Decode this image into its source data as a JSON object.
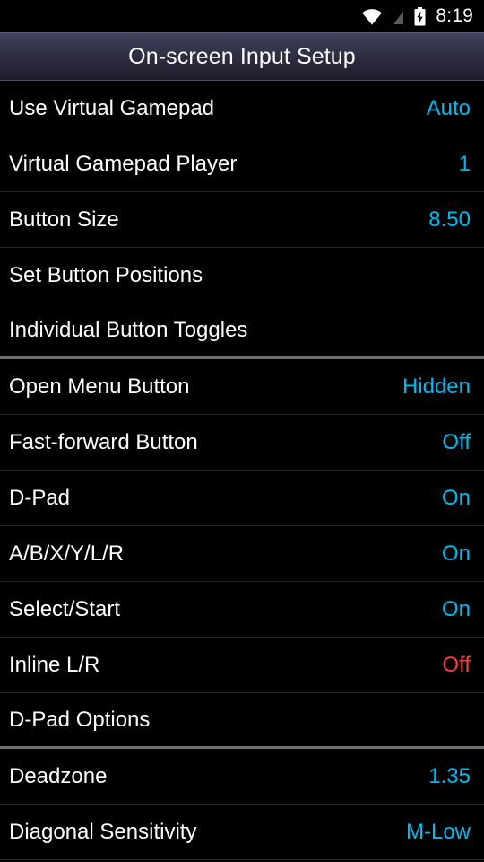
{
  "status_bar": {
    "icons": [
      {
        "name": "wifi-icon",
        "label": "wifi"
      },
      {
        "name": "signal-off-icon",
        "label": "no-signal"
      },
      {
        "name": "battery-charging-icon",
        "label": "battery-charging"
      }
    ],
    "time": "8:19"
  },
  "title_bar": {
    "title": "On-screen Input Setup"
  },
  "colors": {
    "accent": "#00baf0",
    "warn": "#f4433c",
    "background": "#000000",
    "label": "#ffffff",
    "divider": "#262626",
    "section_divider": "#6e6e6e",
    "title_bar_top": "#434360",
    "title_bar_bottom": "#1d1d2a"
  },
  "settings": [
    {
      "label": "Use Virtual Gamepad",
      "value": "Auto",
      "value_style": "accent",
      "section_end": false
    },
    {
      "label": "Virtual Gamepad Player",
      "value": "1",
      "value_style": "accent",
      "section_end": false
    },
    {
      "label": "Button Size",
      "value": "8.50",
      "value_style": "accent",
      "section_end": false
    },
    {
      "label": "Set Button Positions",
      "value": "",
      "value_style": "accent",
      "section_end": false
    },
    {
      "label": "Individual Button Toggles",
      "value": "",
      "value_style": "accent",
      "section_end": true
    },
    {
      "label": "Open Menu Button",
      "value": "Hidden",
      "value_style": "accent",
      "section_end": false
    },
    {
      "label": "Fast-forward Button",
      "value": "Off",
      "value_style": "accent",
      "section_end": false
    },
    {
      "label": "D-Pad",
      "value": "On",
      "value_style": "accent",
      "section_end": false
    },
    {
      "label": "A/B/X/Y/L/R",
      "value": "On",
      "value_style": "accent",
      "section_end": false
    },
    {
      "label": "Select/Start",
      "value": "On",
      "value_style": "accent",
      "section_end": false
    },
    {
      "label": "Inline L/R",
      "value": "Off",
      "value_style": "warn",
      "section_end": false
    },
    {
      "label": "D-Pad Options",
      "value": "",
      "value_style": "accent",
      "section_end": true
    },
    {
      "label": "Deadzone",
      "value": "1.35",
      "value_style": "accent",
      "section_end": false
    },
    {
      "label": "Diagonal Sensitivity",
      "value": "M-Low",
      "value_style": "accent",
      "section_end": false
    }
  ]
}
